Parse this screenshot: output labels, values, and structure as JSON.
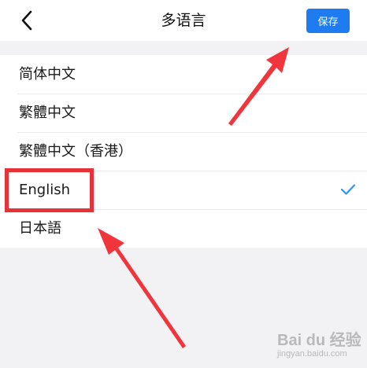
{
  "header": {
    "back_icon": "chevron-left-icon",
    "title": "多语言",
    "save_label": "保存",
    "save_color": "#1f7cf0"
  },
  "languages": {
    "items": [
      {
        "label": "简体中文",
        "selected": false
      },
      {
        "label": "繁體中文",
        "selected": false
      },
      {
        "label": "繁體中文（香港）",
        "selected": false
      },
      {
        "label": "English",
        "selected": true
      },
      {
        "label": "日本語",
        "selected": false
      }
    ],
    "check_icon": "checkmark-icon",
    "check_color": "#3a8ff0"
  },
  "annotations": {
    "highlight_color": "#e8323a"
  },
  "watermark": {
    "main": "Bai du 经验",
    "sub": "jingyan.baidu.com"
  }
}
